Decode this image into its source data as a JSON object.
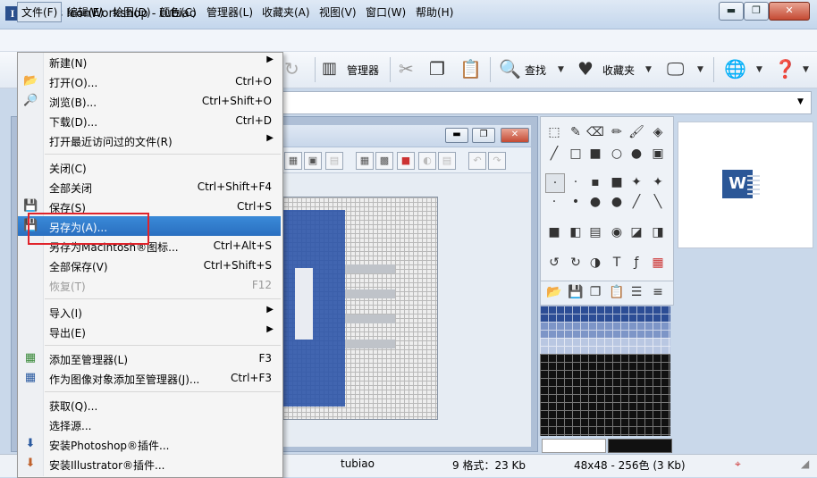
{
  "window": {
    "title": "Axialis IconWorkshop - tubiao",
    "app_icon_letter": "I",
    "min": "▬",
    "max": "❐",
    "close": "✕"
  },
  "menubar": [
    "文件(F)",
    "编辑(E)",
    "绘图(D)",
    "颜色(C)",
    "管理器(L)",
    "收藏夹(A)",
    "视图(V)",
    "窗口(W)",
    "帮助(H)"
  ],
  "toolbar": {
    "manager": "管理器",
    "find": "查找",
    "favorites": "收藏夹"
  },
  "file_menu": {
    "items": [
      {
        "label": "新建(N)",
        "shortcut": "",
        "submenu": true,
        "icon": ""
      },
      {
        "label": "打开(O)...",
        "shortcut": "Ctrl+O",
        "icon": "open-icon"
      },
      {
        "label": "浏览(B)...",
        "shortcut": "Ctrl+Shift+O",
        "icon": "browse-icon"
      },
      {
        "label": "下载(D)...",
        "shortcut": "Ctrl+D",
        "icon": ""
      },
      {
        "label": "打开最近访问过的文件(R)",
        "shortcut": "",
        "submenu": true,
        "icon": ""
      },
      {
        "label": "关闭(C)",
        "shortcut": "",
        "icon": ""
      },
      {
        "label": "全部关闭",
        "shortcut": "Ctrl+Shift+F4",
        "icon": ""
      },
      {
        "label": "保存(S)",
        "shortcut": "Ctrl+S",
        "icon": "save-icon"
      },
      {
        "label": "另存为(A)...",
        "shortcut": "",
        "icon": "save-as-icon"
      },
      {
        "label": "另存为Macintosh®图标...",
        "shortcut": "Ctrl+Alt+S",
        "icon": ""
      },
      {
        "label": "全部保存(V)",
        "shortcut": "Ctrl+Shift+S",
        "icon": ""
      },
      {
        "label": "恢复(T)",
        "shortcut": "F12",
        "icon": ""
      },
      {
        "label": "导入(I)",
        "shortcut": "",
        "submenu": true,
        "icon": ""
      },
      {
        "label": "导出(E)",
        "shortcut": "",
        "submenu": true,
        "icon": ""
      },
      {
        "label": "添加至管理器(L)",
        "shortcut": "F3",
        "icon": "add-manager-icon"
      },
      {
        "label": "作为图像对象添加至管理器(J)...",
        "shortcut": "Ctrl+F3",
        "icon": "add-object-icon"
      },
      {
        "label": "获取(Q)...",
        "shortcut": "",
        "icon": ""
      },
      {
        "label": "选择源...",
        "shortcut": "",
        "icon": ""
      },
      {
        "label": "安装Photoshop®插件...",
        "shortcut": "",
        "icon": "install-icon"
      },
      {
        "label": "安装Illustrator®插件...",
        "shortcut": "",
        "icon": "install-icon"
      }
    ]
  },
  "preview": {
    "logo_letter": "W"
  },
  "statusbar": {
    "doc": "tubiao",
    "formats": "9 格式：23 Kb",
    "size": "48x48 - 256色 (3 Kb)"
  }
}
